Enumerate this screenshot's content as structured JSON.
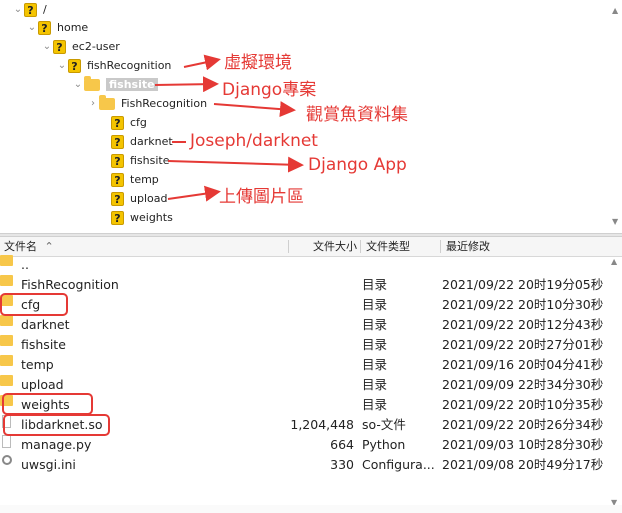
{
  "tree": {
    "nodes": [
      {
        "label": "/"
      },
      {
        "label": "home"
      },
      {
        "label": "ec2-user"
      },
      {
        "label": "fishRecognition"
      },
      {
        "label": "fishsite"
      },
      {
        "label": "FishRecognition"
      },
      {
        "label": "cfg"
      },
      {
        "label": "darknet"
      },
      {
        "label": "fishsite"
      },
      {
        "label": "temp"
      },
      {
        "label": "upload"
      },
      {
        "label": "weights"
      }
    ]
  },
  "annotations": {
    "virtual_env": "虛擬環境",
    "django_project": "Django專案",
    "fish_dataset": "觀賞魚資料集",
    "joseph_darknet": "Joseph/darknet",
    "django_app": "Django App",
    "upload_images": "上傳圖片區"
  },
  "columns": {
    "name": "文件名",
    "size": "文件大小",
    "type": "文件类型",
    "modified": "最近修改"
  },
  "files": [
    {
      "name": "..",
      "size": "",
      "type": "",
      "modified": "",
      "icon": "folder-icon"
    },
    {
      "name": "FishRecognition",
      "size": "",
      "type": "目录",
      "modified": "2021/09/22 20时19分05秒",
      "icon": "folder-icon"
    },
    {
      "name": "cfg",
      "size": "",
      "type": "目录",
      "modified": "2021/09/22 20时10分30秒",
      "icon": "folder-icon"
    },
    {
      "name": "darknet",
      "size": "",
      "type": "目录",
      "modified": "2021/09/22 20时12分43秒",
      "icon": "folder-icon"
    },
    {
      "name": "fishsite",
      "size": "",
      "type": "目录",
      "modified": "2021/09/22 20时27分01秒",
      "icon": "folder-icon"
    },
    {
      "name": "temp",
      "size": "",
      "type": "目录",
      "modified": "2021/09/16 20时04分41秒",
      "icon": "folder-icon"
    },
    {
      "name": "upload",
      "size": "",
      "type": "目录",
      "modified": "2021/09/09 22时34分30秒",
      "icon": "folder-icon"
    },
    {
      "name": "weights",
      "size": "",
      "type": "目录",
      "modified": "2021/09/22 20时10分35秒",
      "icon": "folder-icon"
    },
    {
      "name": "libdarknet.so",
      "size": "1,204,448",
      "type": "so-文件",
      "modified": "2021/09/22 20时26分34秒",
      "icon": "file-icon"
    },
    {
      "name": "manage.py",
      "size": "664",
      "type": "Python",
      "modified": "2021/09/03 10时28分30秒",
      "icon": "file-icon"
    },
    {
      "name": "uwsgi.ini",
      "size": "330",
      "type": "Configura...",
      "modified": "2021/09/08 20时49分17秒",
      "icon": "gear-icon"
    }
  ],
  "colors": {
    "annotation": "#e53935",
    "folder": "#f7c74a",
    "selection": "#c9c9c9"
  }
}
